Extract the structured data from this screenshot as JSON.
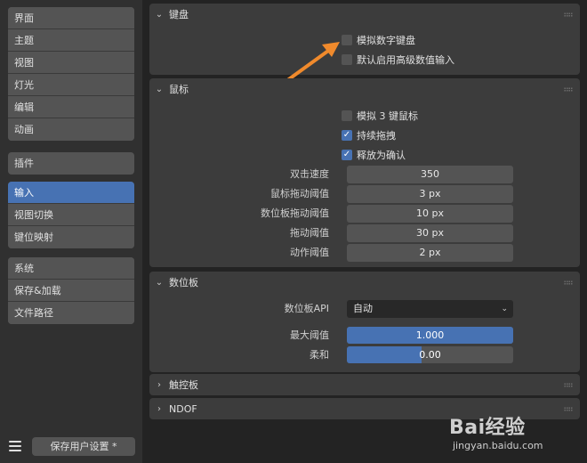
{
  "sidebar": {
    "group1": [
      "界面",
      "主题",
      "视图",
      "灯光",
      "编辑",
      "动画"
    ],
    "group2": [
      "插件"
    ],
    "group3": [
      "输入",
      "视图切换",
      "键位映射"
    ],
    "group4": [
      "系统",
      "保存&加载",
      "文件路径"
    ],
    "active": "输入"
  },
  "footer": {
    "save_label": "保存用户设置 *",
    "menu_icon": "hamburger-menu-icon"
  },
  "keyboard": {
    "title": "键盘",
    "emulate_numpad": {
      "label": "模拟数字键盘",
      "checked": false
    },
    "default_advanced": {
      "label": "默认启用高级数值输入",
      "checked": false
    }
  },
  "mouse": {
    "title": "鼠标",
    "emulate_3btn": {
      "label": "模拟 3 键鼠标",
      "checked": false
    },
    "continuous_grab": {
      "label": "持续拖拽",
      "checked": true
    },
    "release_confirm": {
      "label": "释放为确认",
      "checked": true
    },
    "fields": [
      {
        "label": "双击速度",
        "value": "350"
      },
      {
        "label": "鼠标拖动阈值",
        "value": "3 px"
      },
      {
        "label": "数位板拖动阈值",
        "value": "10 px"
      },
      {
        "label": "拖动阈值",
        "value": "30 px"
      },
      {
        "label": "动作阈值",
        "value": "2 px"
      }
    ]
  },
  "tablet": {
    "title": "数位板",
    "api_label": "数位板API",
    "api_value": "自动",
    "max_label": "最大阈值",
    "max_value": "1.000",
    "max_fraction": 1.0,
    "softness_label": "柔和",
    "softness_value": "0.00",
    "softness_fraction": 0.45
  },
  "touchpad": {
    "title": "触控板"
  },
  "ndof": {
    "title": "NDOF"
  },
  "watermark": {
    "logo": "Bai经验",
    "url": "jingyan.baidu.com"
  },
  "colors": {
    "accent": "#4772b3",
    "arrow": "#f08a2c",
    "panel": "#3c3c3c",
    "background": "#232323"
  }
}
